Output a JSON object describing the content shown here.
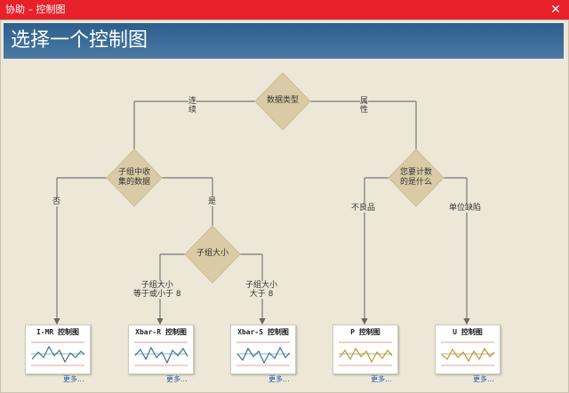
{
  "window": {
    "title": "协助 – 控制图",
    "close_glyph": "✕"
  },
  "header": {
    "title": "选择一个控制图"
  },
  "nodes": {
    "data_type": "数据类型",
    "subgroup_collect": "子组中收\n集的数据",
    "subgroup_size": "子组大小",
    "count_what": "您要计数\n的是什么"
  },
  "edges": {
    "continuous": "连\n续",
    "attribute": "属\n性",
    "no": "否",
    "yes": "是",
    "size_le8": "子组大小\n等于或小于 8",
    "size_gt8": "子组大小\n大于 8",
    "defectives": "不良品",
    "defects_per_unit": "单位缺陷"
  },
  "charts": [
    {
      "label": "I-MR 控制图",
      "more": "更多..."
    },
    {
      "label": "Xbar-R 控制图",
      "more": "更多..."
    },
    {
      "label": "Xbar-S 控制图",
      "more": "更多..."
    },
    {
      "label": "P 控制图",
      "more": "更多..."
    },
    {
      "label": "U 控制图",
      "more": "更多..."
    }
  ],
  "colors": {
    "titlebar": "#e8202a",
    "header": "#3a6b97",
    "diamond": "#d9cba5",
    "line_blue": "#3b6fa6",
    "line_gold": "#c9952c",
    "limit_line": "#d08a7a",
    "link": "#1f55a8"
  }
}
